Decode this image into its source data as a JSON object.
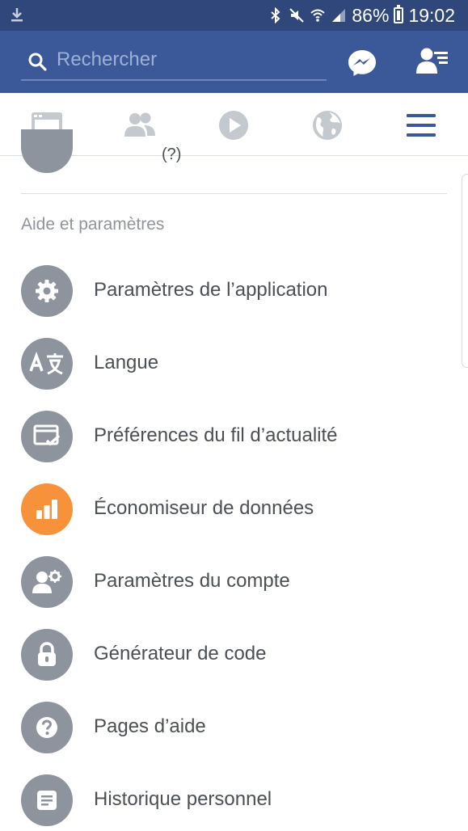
{
  "status_bar": {
    "battery": "86%",
    "time": "19:02"
  },
  "search": {
    "placeholder": "Rechercher"
  },
  "colors": {
    "header": "#3b5998",
    "status_bar": "#2f477a",
    "icon_circle": "#8d949e",
    "accent": "#f7923a",
    "active_tab": "#3b5998"
  },
  "tabs": [
    {
      "icon": "news-feed-icon"
    },
    {
      "icon": "friends-icon"
    },
    {
      "icon": "video-icon"
    },
    {
      "icon": "globe-icon"
    },
    {
      "icon": "menu-icon",
      "active": true
    }
  ],
  "partial_item": {
    "label": "(?)"
  },
  "section": {
    "title": "Aide et paramètres"
  },
  "menu_items": [
    {
      "label": "Paramètres de l’application",
      "icon": "gear-icon"
    },
    {
      "label": "Langue",
      "icon": "translate-icon"
    },
    {
      "label": "Préférences du fil d’actualité",
      "icon": "feed-preferences-icon"
    },
    {
      "label": "Économiseur de données",
      "icon": "data-saver-icon"
    },
    {
      "label": "Paramètres du compte",
      "icon": "account-settings-icon"
    },
    {
      "label": "Générateur de code",
      "icon": "lock-icon"
    },
    {
      "label": "Pages d’aide",
      "icon": "help-icon"
    },
    {
      "label": "Historique personnel",
      "icon": "activity-log-icon"
    }
  ]
}
